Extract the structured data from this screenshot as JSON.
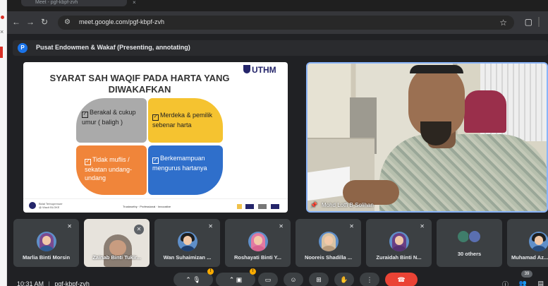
{
  "browser": {
    "tab_title": "Meet - pgf-kbpf-zvh",
    "url": "meet.google.com/pgf-kbpf-zvh"
  },
  "presenting": {
    "avatar_letter": "P",
    "label": "Pusat Endowmen & Wakaf (Presenting, annotating)"
  },
  "slide": {
    "title_line1": "SYARAT  SAH WAQIF PADA HARTA YANG",
    "title_line2": "DIWAKAFKAN",
    "logo_text": "UTHM",
    "items": [
      "Berakal & cukup umur ( baligh )",
      "Merdeka & pemilik sebenar harta",
      "Tidak muflis / sekatan undang-undang",
      "Berkemampuan mengurus hartanya"
    ],
    "footer_tagline": "Trustworthy · Professional · Innovative",
    "footer_left": "Bidal Terbuprenuer\n@ Wacit BLOKE"
  },
  "presenter": {
    "name": "Mohd Lotfi B Solihan"
  },
  "participants": [
    {
      "name": "Marlia Binti Morsin",
      "avatar": "hijab-purple"
    },
    {
      "name": "Zainab Binti Tukir...",
      "avatar": "photo"
    },
    {
      "name": "Wan Suhaimizan ...",
      "avatar": "man"
    },
    {
      "name": "Roshayati Binti Y...",
      "avatar": "hijab-pink"
    },
    {
      "name": "Nooreis Shadilla ...",
      "avatar": "hijab-beige"
    },
    {
      "name": "Zuraidah Binti N...",
      "avatar": "hijab-purple"
    },
    {
      "name": "30 others",
      "avatar": "group"
    },
    {
      "name": "Muhamad Az...",
      "avatar": "man"
    }
  ],
  "bottom_bar": {
    "time": "10:31 AM",
    "separator": "|",
    "meeting_code": "pgf-kbpf-zvh",
    "participant_count": "39"
  },
  "colors": {
    "meet_bg": "#202124",
    "tile_bg": "#3c4043",
    "accent_blue": "#8ab4f8",
    "end_call_red": "#ea4335",
    "petal_grey": "#aaaaaa",
    "petal_yellow": "#f5c330",
    "petal_orange": "#f0853a",
    "petal_blue": "#2f6fcb"
  }
}
